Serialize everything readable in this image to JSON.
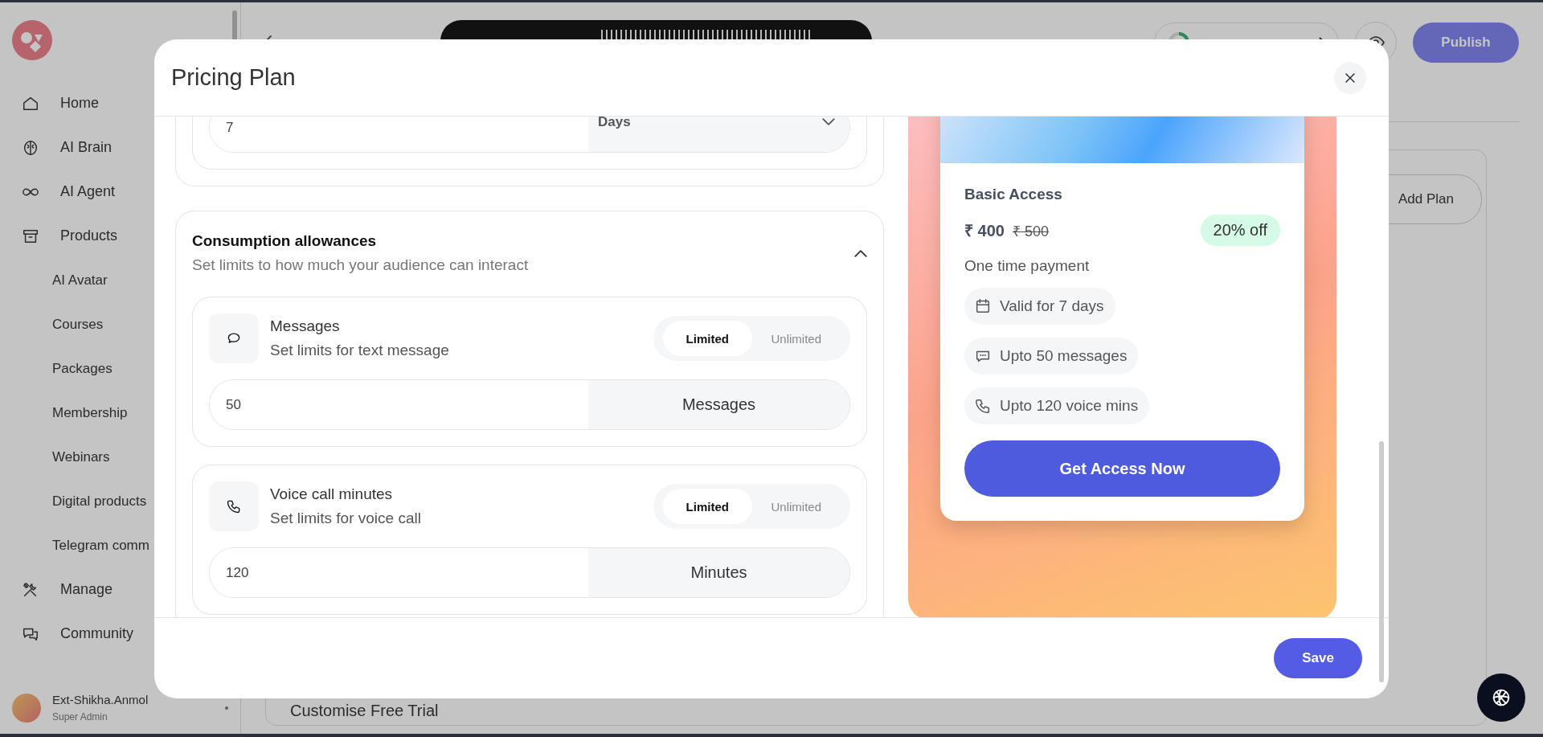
{
  "sidebar": {
    "items": [
      {
        "label": "Home"
      },
      {
        "label": "AI Brain"
      },
      {
        "label": "AI Agent"
      },
      {
        "label": "Products",
        "children": [
          {
            "label": "AI Avatar"
          },
          {
            "label": "Courses"
          },
          {
            "label": "Packages"
          },
          {
            "label": "Membership"
          },
          {
            "label": "Webinars"
          },
          {
            "label": "Digital products"
          },
          {
            "label": "Telegram comm"
          }
        ]
      },
      {
        "label": "Manage"
      },
      {
        "label": "Community"
      }
    ],
    "user": {
      "name": "Ext-Shikha.Anmol",
      "role": "Super Admin"
    }
  },
  "header": {
    "publish": "Publish"
  },
  "plans": {
    "add_plan": "Add Plan",
    "free_trial": "Customise Free Trial"
  },
  "modal": {
    "title": "Pricing Plan",
    "duration": {
      "value": "7",
      "unit": "Days"
    },
    "consumption": {
      "title": "Consumption allowances",
      "subtitle": "Set limits to how much your audience can interact",
      "expanded": true,
      "items": [
        {
          "kind": "message",
          "title": "Messages",
          "subtitle": "Set limits for text message",
          "options": [
            {
              "label": "Limited",
              "selected": true
            },
            {
              "label": "Unlimited",
              "selected": false
            }
          ],
          "value": "50",
          "unit": "Messages"
        },
        {
          "kind": "voice",
          "title": "Voice call minutes",
          "subtitle": "Set limits for voice call",
          "options": [
            {
              "label": "Limited",
              "selected": true
            },
            {
              "label": "Unlimited",
              "selected": false
            }
          ],
          "value": "120",
          "unit": "Minutes"
        }
      ]
    },
    "preview": {
      "name": "Basic Access",
      "price": "₹ 400",
      "old_price": "₹ 500",
      "discount": "20% off",
      "payment": "One time payment",
      "features": [
        {
          "kind": "validity",
          "text": "Valid for 7 days"
        },
        {
          "kind": "message",
          "text": "Upto 50 messages"
        },
        {
          "kind": "voice",
          "text": "Upto 120 voice mins"
        }
      ],
      "cta": "Get Access Now"
    },
    "save": "Save"
  }
}
